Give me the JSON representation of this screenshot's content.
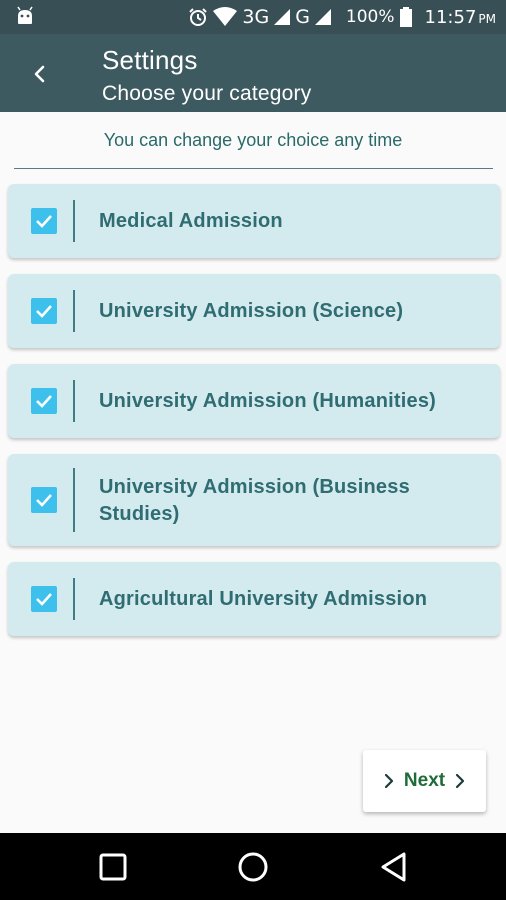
{
  "status_bar": {
    "network_3g": "3G",
    "network_g": "G",
    "battery": "100%",
    "time": "11:57",
    "time_suffix": "PM"
  },
  "app_bar": {
    "title": "Settings",
    "subtitle": "Choose your category"
  },
  "hint": "You can change your choice any time",
  "categories": [
    {
      "label": "Medical Admission",
      "checked": true
    },
    {
      "label": "University Admission (Science)",
      "checked": true
    },
    {
      "label": "University Admission (Humanities)",
      "checked": true
    },
    {
      "label": "University Admission (Business Studies)",
      "checked": true
    },
    {
      "label": "Agricultural University Admission",
      "checked": true
    }
  ],
  "next_button": {
    "label": "Next"
  },
  "colors": {
    "app_bar": "#3e5a61",
    "status_bar": "#384f55",
    "card_bg": "#d3eaee",
    "checkbox": "#3ec0ec",
    "label_text": "#2f6d72",
    "next_text": "#1f6b3a"
  }
}
